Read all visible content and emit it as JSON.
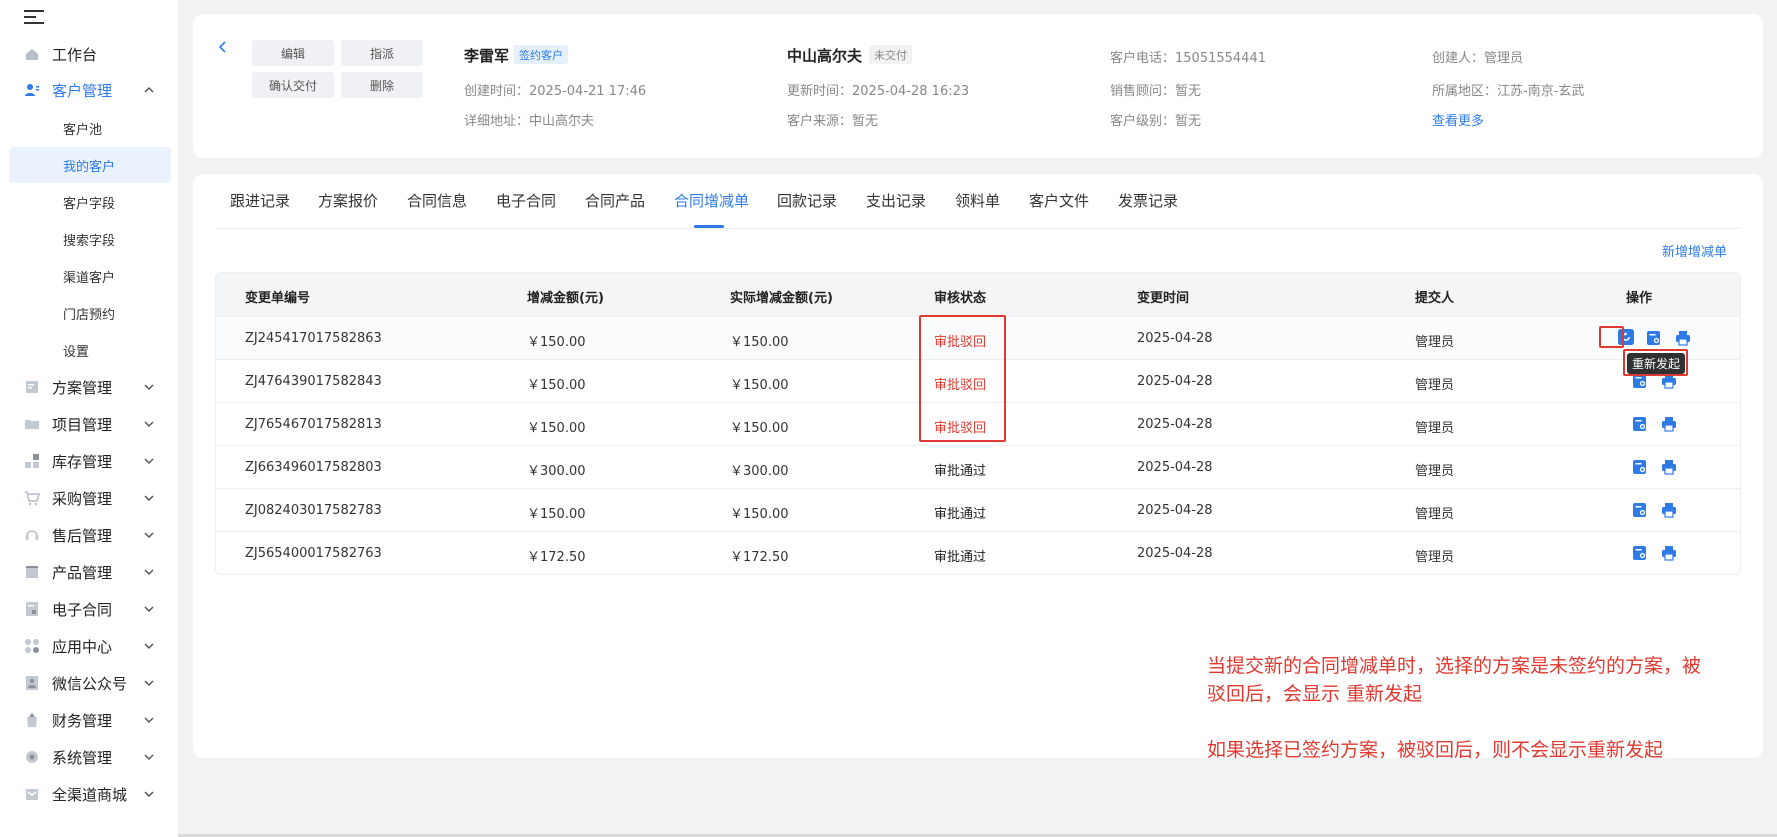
{
  "sidebar": {
    "menu_toggle_icon": "menu-fold-icon",
    "top_items": [
      {
        "label": "工作台",
        "icon": "home-icon"
      },
      {
        "label": "客户管理",
        "icon": "customer-icon"
      }
    ],
    "customer_sub": [
      {
        "label": "客户池"
      },
      {
        "label": "我的客户"
      },
      {
        "label": "客户字段"
      },
      {
        "label": "搜索字段"
      },
      {
        "label": "渠道客户"
      },
      {
        "label": "门店预约"
      },
      {
        "label": "设置"
      }
    ],
    "groups": [
      {
        "label": "方案管理",
        "icon": "plan-icon"
      },
      {
        "label": "项目管理",
        "icon": "folder-icon"
      },
      {
        "label": "库存管理",
        "icon": "inventory-icon"
      },
      {
        "label": "采购管理",
        "icon": "cart-icon"
      },
      {
        "label": "售后管理",
        "icon": "headset-icon"
      },
      {
        "label": "产品管理",
        "icon": "product-icon"
      },
      {
        "label": "电子合同",
        "icon": "contract-icon"
      },
      {
        "label": "应用中心",
        "icon": "apps-icon"
      },
      {
        "label": "微信公众号",
        "icon": "wechat-icon"
      },
      {
        "label": "财务管理",
        "icon": "finance-icon"
      },
      {
        "label": "系统管理",
        "icon": "system-icon"
      },
      {
        "label": "全渠道商城",
        "icon": "mall-icon"
      }
    ]
  },
  "header": {
    "buttons": {
      "edit": "编辑",
      "assign": "指派",
      "confirm_delivery": "确认交付",
      "delete": "删除"
    },
    "customer_name": "李雷军",
    "customer_tag": "签约客户",
    "created_time": "创建时间：2025-04-21 17:46",
    "address": "详细地址：中山高尔夫",
    "project_name": "中山高尔夫",
    "delivery_tag": "未交付",
    "updated_time": "更新时间：2025-04-28 16:23",
    "customer_source": "客户来源：暂无",
    "phone": "客户电话：15051554441",
    "sales_advisor": "销售顾问：暂无",
    "customer_level": "客户级别：暂无",
    "creator": "创建人：管理员",
    "region": "所属地区：江苏-南京-玄武",
    "view_more": "查看更多"
  },
  "tabs": [
    "跟进记录",
    "方案报价",
    "合同信息",
    "电子合同",
    "合同产品",
    "合同增减单",
    "回款记录",
    "支出记录",
    "领料单",
    "客户文件",
    "发票记录"
  ],
  "active_tab": "合同增减单",
  "new_button": "新增增减单",
  "table": {
    "headers": [
      "变更单编号",
      "增减金额(元)",
      "实际增减金额(元)",
      "审核状态",
      "变更时间",
      "提交人",
      "操作"
    ],
    "rows": [
      {
        "id": "ZJ245417017582863",
        "amount": "￥150.00",
        "actual": "￥150.00",
        "status": "审批驳回",
        "time": "2025-04-28",
        "submitter": "管理员"
      },
      {
        "id": "ZJ476439017582843",
        "amount": "￥150.00",
        "actual": "￥150.00",
        "status": "审批驳回",
        "time": "2025-04-28",
        "submitter": "管理员"
      },
      {
        "id": "ZJ765467017582813",
        "amount": "￥150.00",
        "actual": "￥150.00",
        "status": "审批驳回",
        "time": "2025-04-28",
        "submitter": "管理员"
      },
      {
        "id": "ZJ663496017582803",
        "amount": "￥300.00",
        "actual": "￥300.00",
        "status": "审批通过",
        "time": "2025-04-28",
        "submitter": "管理员"
      },
      {
        "id": "ZJ082403017582783",
        "amount": "￥150.00",
        "actual": "￥150.00",
        "status": "审批通过",
        "time": "2025-04-28",
        "submitter": "管理员"
      },
      {
        "id": "ZJ565400017582763",
        "amount": "￥172.50",
        "actual": "￥172.50",
        "status": "审批通过",
        "time": "2025-04-28",
        "submitter": "管理员"
      }
    ],
    "op_icons": [
      "restart-icon",
      "view-detail-icon",
      "print-icon"
    ]
  },
  "tooltip": "重新发起",
  "notes": {
    "line1": "当提交新的合同增减单时，选择的方案是未签约的方案，被",
    "line2": "驳回后，会显示 重新发起",
    "line3": "如果选择已签约方案，被驳回后，则不会显示重新发起"
  },
  "colors": {
    "accent": "#2e7be6",
    "reject": "#e0392f",
    "annotation": "#e0392f"
  }
}
